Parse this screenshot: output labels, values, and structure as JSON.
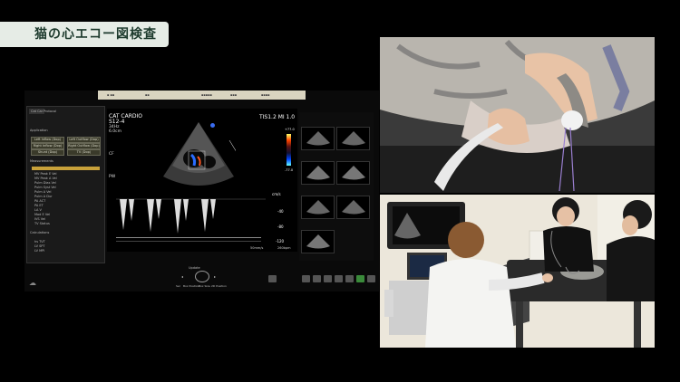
{
  "title": "猫の心エコー図検査",
  "monitor": {
    "tabs": [
      "Cat Car",
      "Protocol"
    ],
    "mode_text": "CAT CARDIO",
    "probe_text": "S12-4",
    "freq_text": "34Hz",
    "depth_text": "6.0cm",
    "ti_mi_text": "TIS1.2  MI  1.0",
    "cf_text": "CF",
    "pw_text": "PW",
    "speed_text": "50mm/s",
    "bpm_text": "260bpm",
    "scale_labels": [
      "cm/s",
      "-40",
      "-80",
      "-120"
    ],
    "colorbar_top": "+77.0",
    "colorbar_bottom": "-77.0",
    "application_label": "Application",
    "measurements_label": "Measurements",
    "calculations_label": "Calculations",
    "left_buttons": [
      "Left Inflow (Dop)",
      "Left Outflow (Dop)",
      "Right Inflow (Dop)",
      "Right Outflow (Dop)",
      "Shunt (Dop)",
      "TV (Dop)"
    ],
    "measure_items": [
      "MV Peak E Vel",
      "MV Peak A Vel",
      "Pulm Dias Vel",
      "Pulm Syst Vel",
      "Pulm A Vel",
      "Pulm A Dur",
      "PA ACT",
      "PA ET",
      "LA V",
      "Mod E Vel",
      "IVS Vel",
      "TV Status"
    ],
    "calc_items": [
      "hs TVT",
      "LV SPT",
      "LV MPI"
    ],
    "bottom_labels": [
      "Sel",
      "Box Position",
      "Box Size",
      "2D Position"
    ],
    "update_label": "Update"
  }
}
